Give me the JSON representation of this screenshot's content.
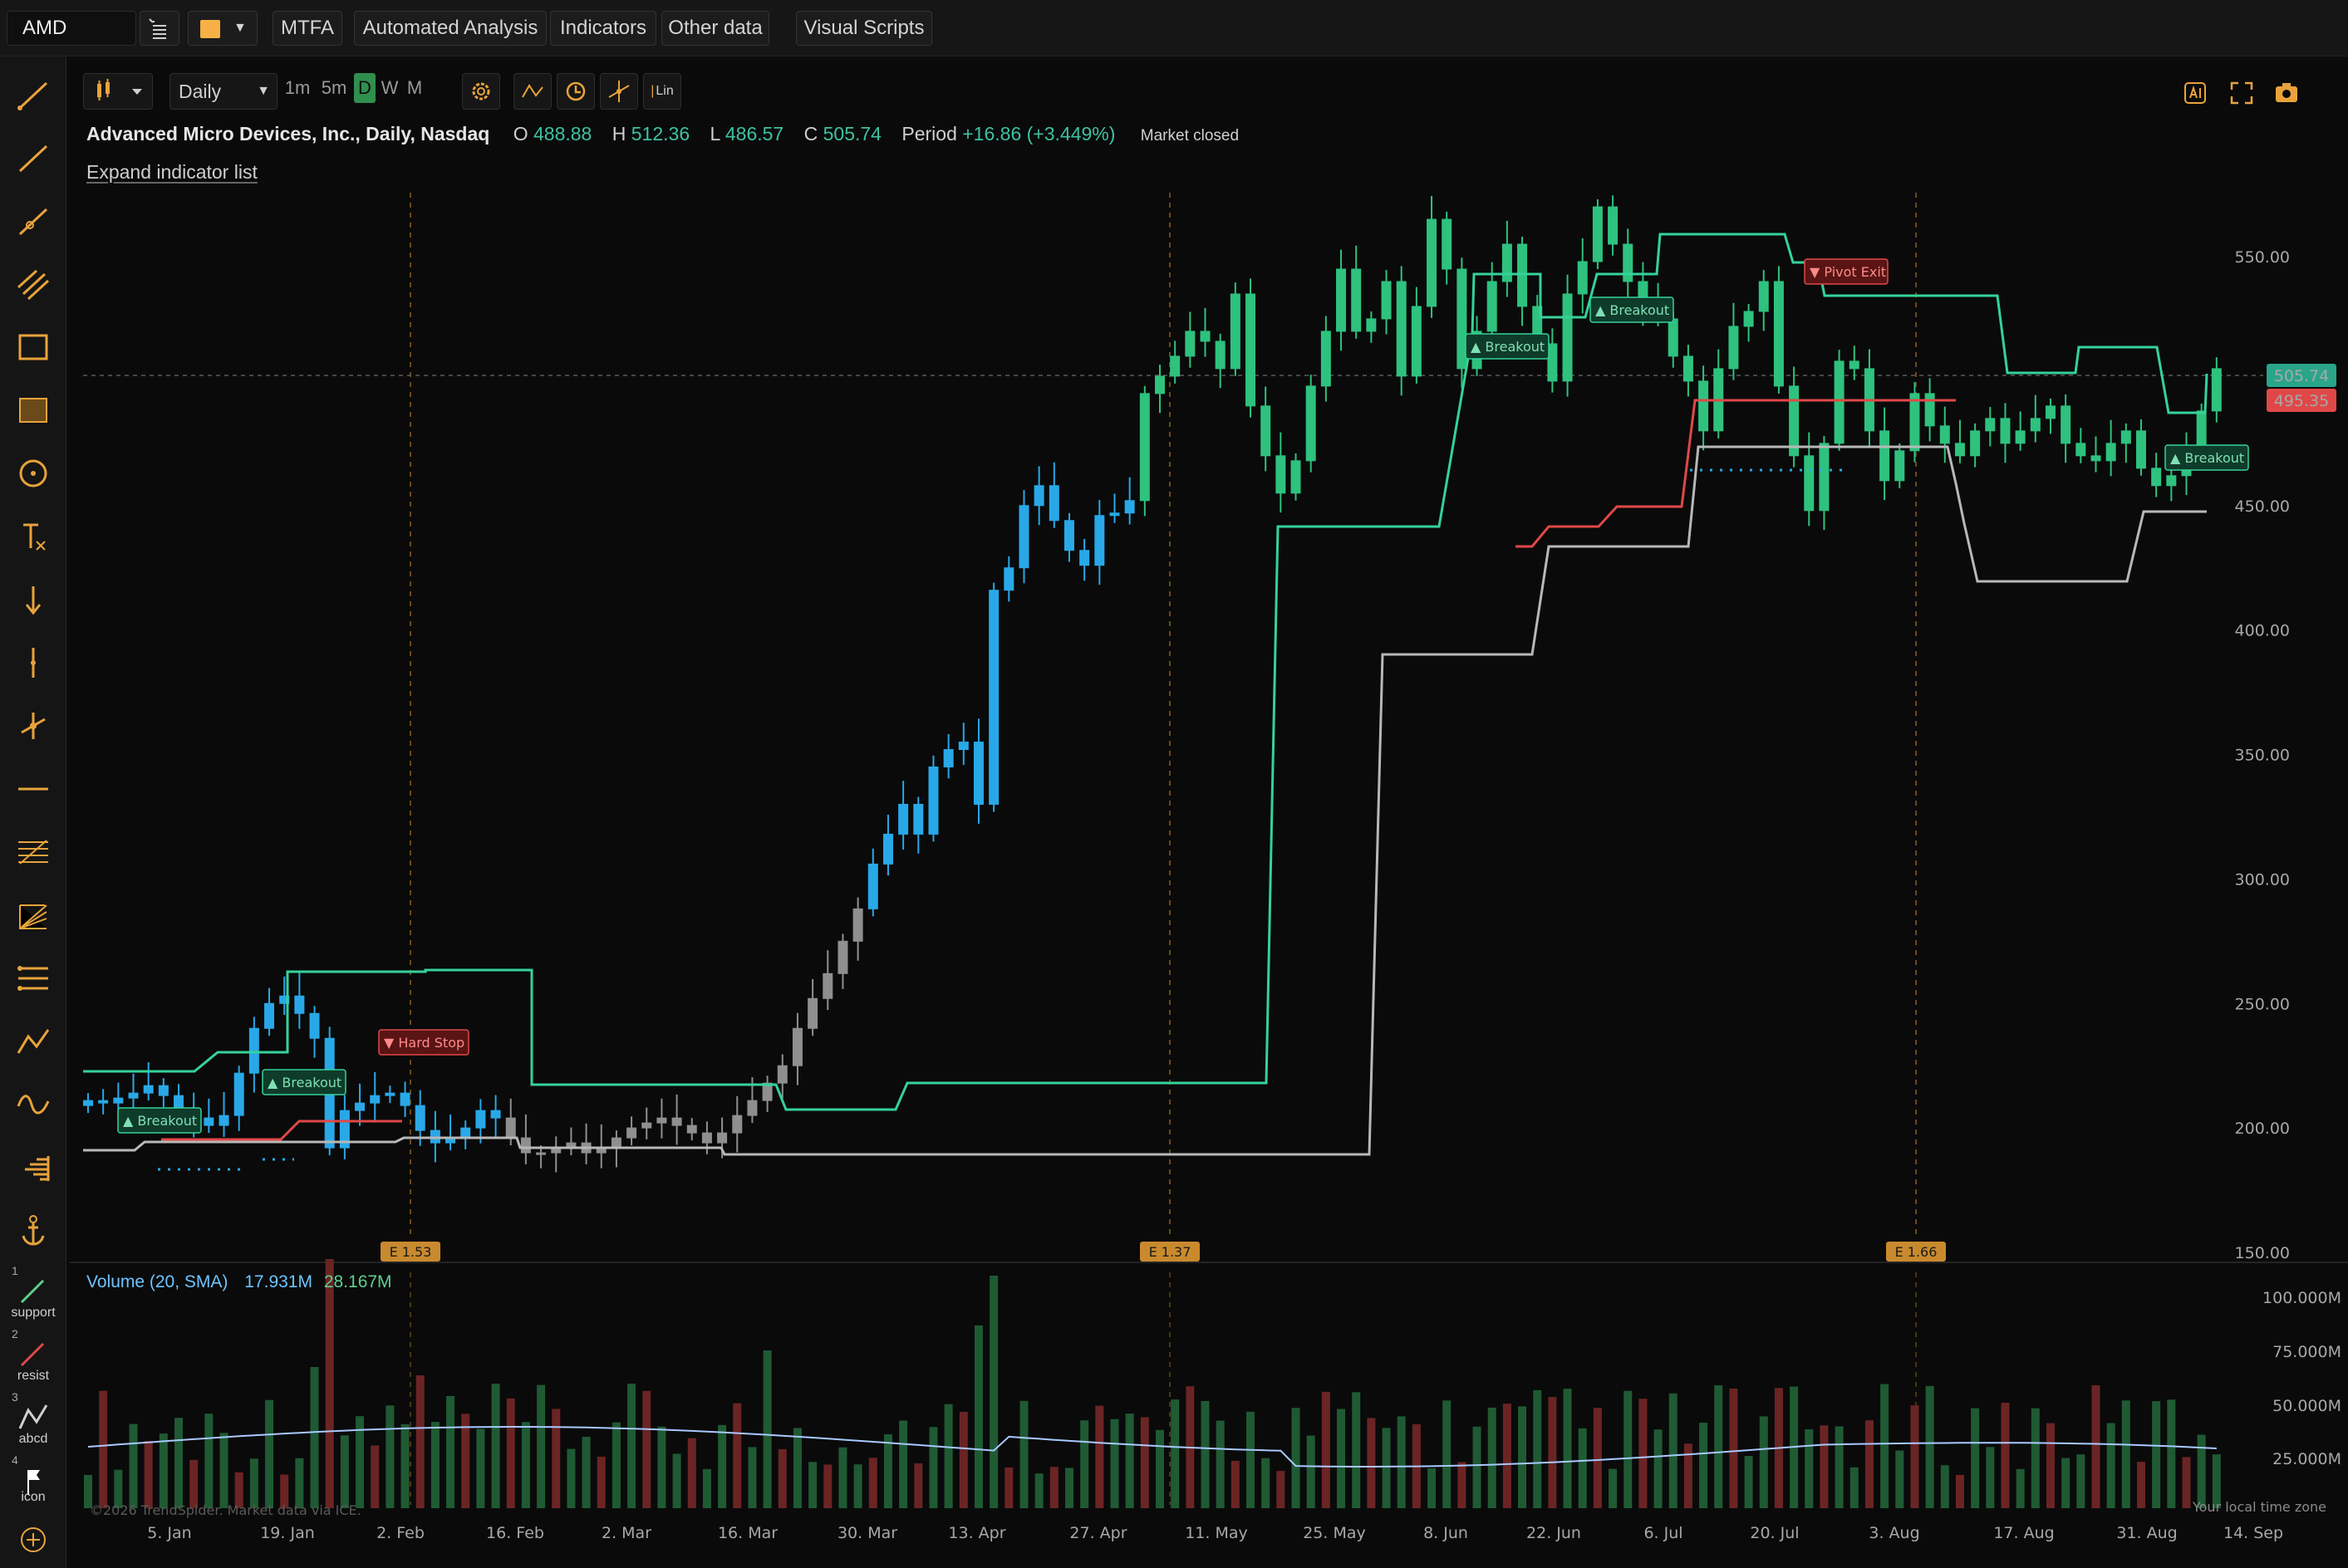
{
  "topbar": {
    "symbol": "AMD",
    "buttons": [
      "MTFA",
      "Automated Analysis",
      "Indicators",
      "Other data",
      "Visual Scripts"
    ],
    "color": "#f7b046"
  },
  "chart_toolbar": {
    "interval": "Daily",
    "timeframes": [
      "1m",
      "5m",
      "D",
      "W",
      "M"
    ],
    "active_timeframe": "D",
    "scale_label": "Lin"
  },
  "legend": {
    "title": "Advanced Micro Devices, Inc., Daily, Nasdaq",
    "o_label": "O",
    "o": "488.88",
    "h_label": "H",
    "h": "512.36",
    "l_label": "L",
    "l": "486.57",
    "c_label": "C",
    "c": "505.74",
    "period_label": "Period",
    "period": "+16.86 (+3.449%)",
    "status": "Market closed",
    "expand": "Expand indicator list"
  },
  "volume_legend": {
    "name": "Volume (20, SMA)",
    "v1": "17.931M",
    "v2": "28.167M"
  },
  "quick_tools": [
    {
      "num": "1",
      "label": "support"
    },
    {
      "num": "2",
      "label": "resist"
    },
    {
      "num": "3",
      "label": "abcd"
    },
    {
      "num": "4",
      "label": "icon"
    }
  ],
  "price_tags": {
    "last": "505.74",
    "prev": "495.35"
  },
  "earnings": [
    "E 1.53",
    "E 1.37",
    "E 1.66"
  ],
  "signals": [
    "Breakout",
    "Breakout",
    "Hard Stop",
    "Breakout",
    "Breakout",
    "Pivot Exit",
    "Breakout"
  ],
  "footer": {
    "copyright": "©2026 TrendSpider. Market data via ICE.",
    "tz": "Your local time zone"
  },
  "colors": {
    "up": "#2ec27e",
    "down": "#2ec27e",
    "pre": "#29a8e8",
    "gray": "#8f8f8f",
    "channel": "#34d399",
    "stop": "#b8b8b8",
    "red": "#e04848"
  },
  "chart_data": {
    "type": "candlestick",
    "y_axis": {
      "ticks": [
        150,
        200,
        250,
        300,
        350,
        400,
        450,
        550
      ],
      "min": 150,
      "max": 575
    },
    "volume_axis": {
      "ticks": [
        "100.000M",
        "75.000M",
        "50.000M",
        "25.000M"
      ]
    },
    "x_ticks": [
      "5. Jan",
      "19. Jan",
      "2. Feb",
      "16. Feb",
      "2. Mar",
      "16. Mar",
      "30. Mar",
      "13. Apr",
      "27. Apr",
      "11. May",
      "25. May",
      "8. Jun",
      "22. Jun",
      "6. Jul",
      "20. Jul",
      "3. Aug",
      "17. Aug",
      "31. Aug",
      "14. Sep"
    ],
    "closes": [
      211,
      210,
      212,
      214,
      217,
      213,
      208,
      204,
      201,
      205,
      222,
      240,
      250,
      253,
      246,
      236,
      192,
      207,
      210,
      213,
      214,
      209,
      199,
      194,
      196,
      200,
      207,
      204,
      196,
      190,
      190,
      192,
      194,
      190,
      192,
      196,
      200,
      202,
      204,
      201,
      198,
      194,
      198,
      205,
      211,
      218,
      225,
      240,
      252,
      262,
      275,
      288,
      306,
      318,
      330,
      318,
      345,
      352,
      355,
      330,
      416,
      425,
      450,
      458,
      444,
      432,
      426,
      446,
      447,
      452,
      495,
      502,
      510,
      520,
      516,
      505,
      535,
      490,
      470,
      455,
      468,
      498,
      520,
      545,
      520,
      525,
      540,
      502,
      530,
      565,
      545,
      505,
      520,
      540,
      555,
      530,
      515,
      500,
      535,
      548,
      570,
      555,
      540,
      530,
      525,
      510,
      500,
      480,
      505,
      522,
      528,
      540,
      498,
      470,
      448,
      475,
      508,
      505,
      480,
      460,
      472,
      495,
      482,
      475,
      470,
      480,
      485,
      475,
      480,
      485,
      490,
      475,
      470,
      468,
      475,
      480,
      465,
      458,
      462,
      470,
      488,
      505
    ]
  }
}
